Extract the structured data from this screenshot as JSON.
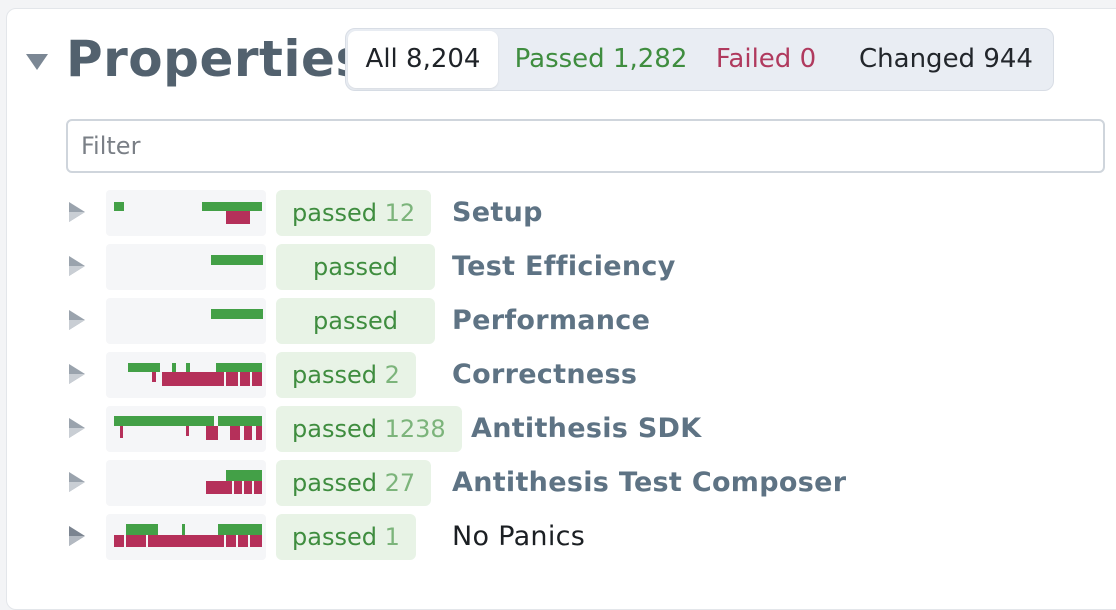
{
  "header": {
    "title": "Properties",
    "tabs": [
      {
        "label": "All",
        "count": "8,204"
      },
      {
        "label": "Passed",
        "count": "1,282"
      },
      {
        "label": "Failed",
        "count": "0"
      },
      {
        "label": "Changed",
        "count": "944"
      }
    ]
  },
  "filter": {
    "placeholder": "Filter",
    "value": ""
  },
  "colors": {
    "pass": "#43a047",
    "fail": "#b5305a"
  },
  "rows": [
    {
      "status": "passed",
      "count": "12",
      "name": "Setup",
      "dark": false
    },
    {
      "status": "passed",
      "count": "",
      "name": "Test Efficiency",
      "dark": false
    },
    {
      "status": "passed",
      "count": "",
      "name": "Performance",
      "dark": false
    },
    {
      "status": "passed",
      "count": "2",
      "name": "Correctness",
      "dark": false
    },
    {
      "status": "passed",
      "count": "1238",
      "name": "Antithesis SDK",
      "dark": false
    },
    {
      "status": "passed",
      "count": "27",
      "name": "Antithesis Test Composer",
      "dark": false
    },
    {
      "status": "passed",
      "count": "1",
      "name": "No Panics",
      "dark": true
    }
  ]
}
